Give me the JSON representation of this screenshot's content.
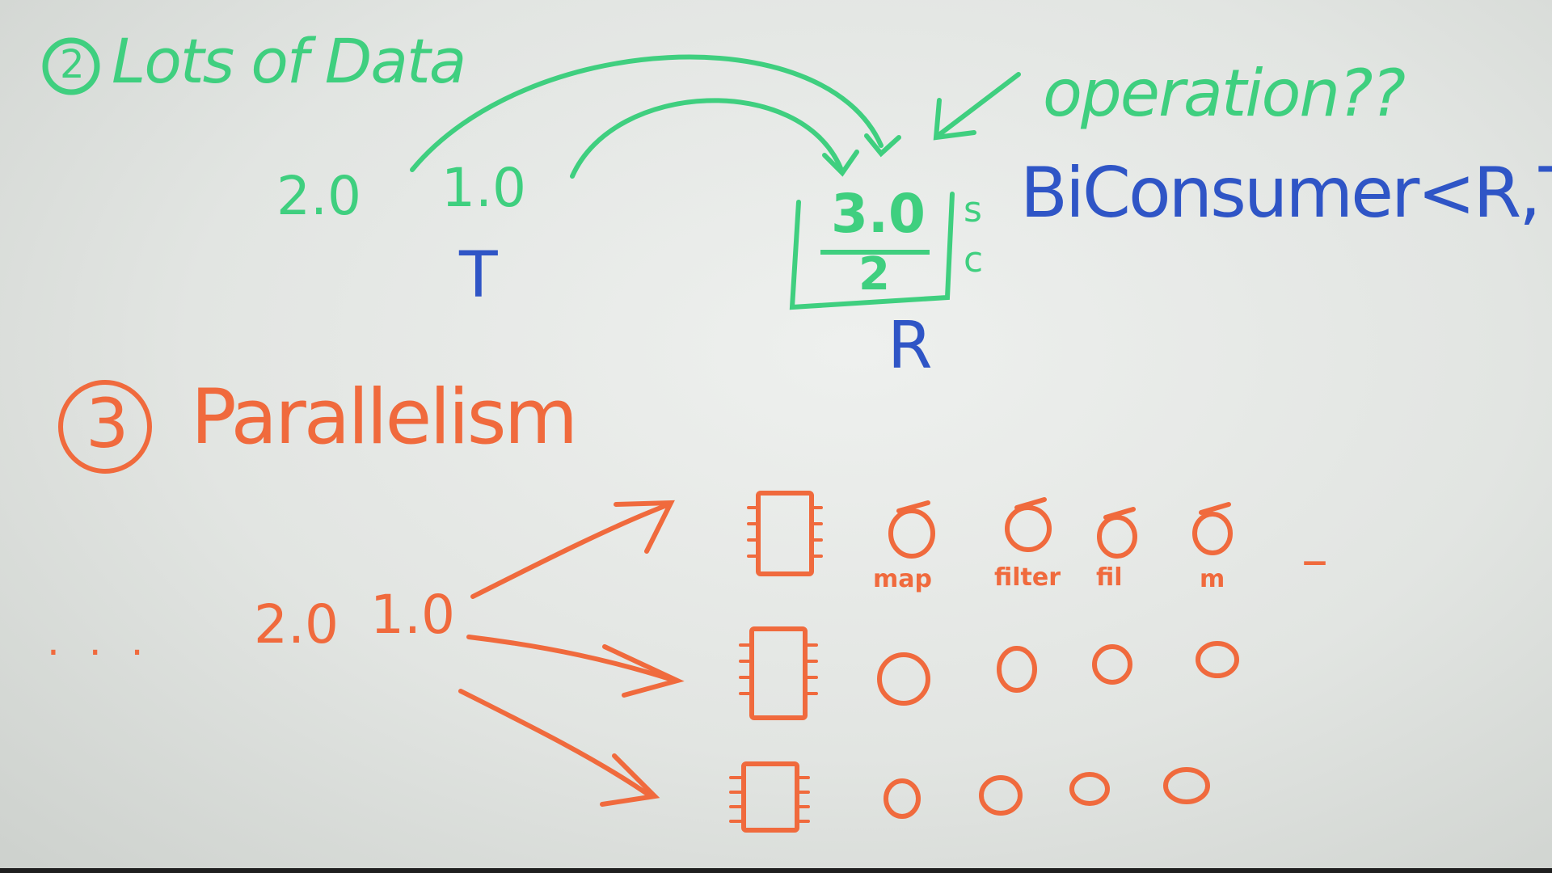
{
  "section_data": {
    "heading": "Lots of Data",
    "number": "2",
    "values": [
      "2.0",
      "1.0"
    ],
    "type_T": "T",
    "result_top": "3.0",
    "result_bottom": "2",
    "result_side_top": "s",
    "result_side_bottom": "c",
    "type_R": "R",
    "operation_label": "operation??",
    "biconsumer": "BiConsumer<R,T>"
  },
  "section_parallelism": {
    "number": "3",
    "heading": "Parallelism",
    "dots": ". . .",
    "values": [
      "2.0",
      "1.0"
    ],
    "op_labels": [
      "map",
      "filter",
      "fil",
      "m"
    ],
    "dash": "–"
  },
  "colors": {
    "green": "#3fcf7f",
    "blue": "#2f55c6",
    "orange": "#f06a3d"
  }
}
